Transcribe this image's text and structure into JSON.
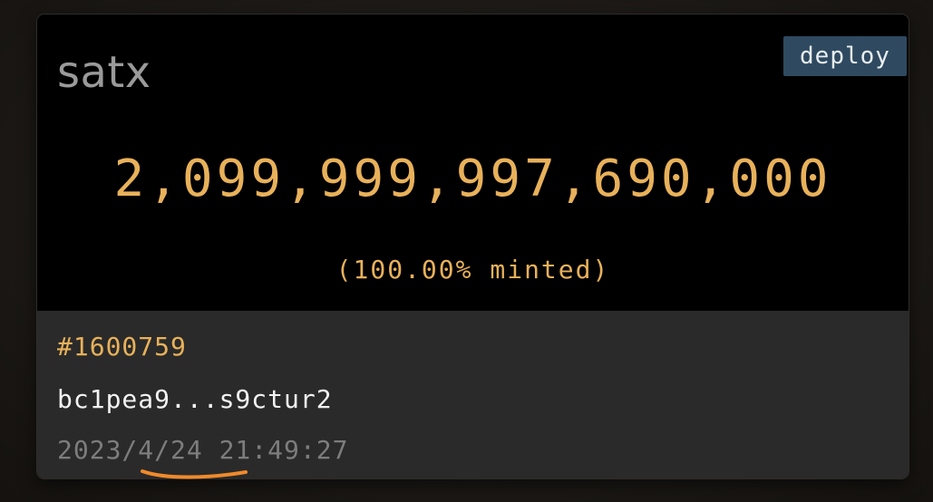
{
  "card": {
    "ticker": "satx",
    "operation": "deploy",
    "supply": "2,099,999,997,690,000",
    "minted_text": "(100.00% minted)",
    "inscription_number": "#1600759",
    "deployer_address": "bc1pea9...s9ctur2",
    "timestamp": "2023/4/24 21:49:27"
  },
  "colors": {
    "supply": "#e8b15a",
    "badge_bg": "#2f4a60",
    "footer_bg": "#2a2a2a",
    "underline_mark": "#f08a2b"
  }
}
